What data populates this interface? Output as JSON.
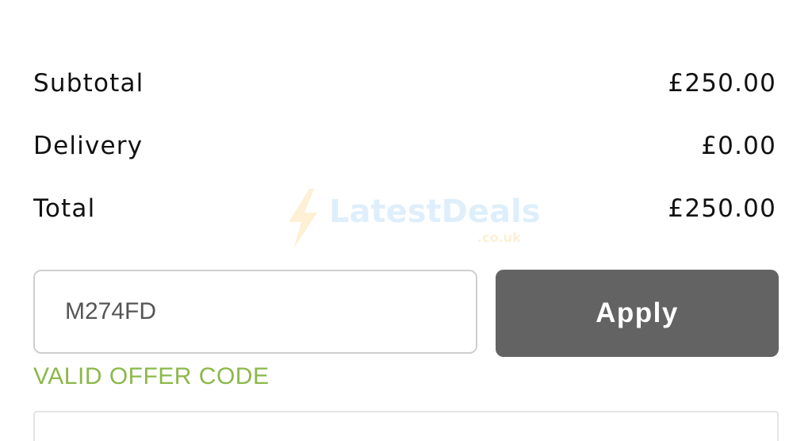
{
  "summary": {
    "subtotal": {
      "label": "Subtotal",
      "value": "£250.00"
    },
    "delivery": {
      "label": "Delivery",
      "value": "£0.00"
    },
    "total": {
      "label": "Total",
      "value": "£250.00"
    }
  },
  "watermark": {
    "brand": "LatestDeals",
    "domain": ".co.uk",
    "icon": "lightning-bolt-icon"
  },
  "offer_code": {
    "value": "M274FD",
    "apply_label": "Apply",
    "status_message": "VALID OFFER CODE"
  },
  "colors": {
    "button_bg": "#636363",
    "valid_green": "#8cb84a",
    "input_border": "#cfcfcf"
  }
}
